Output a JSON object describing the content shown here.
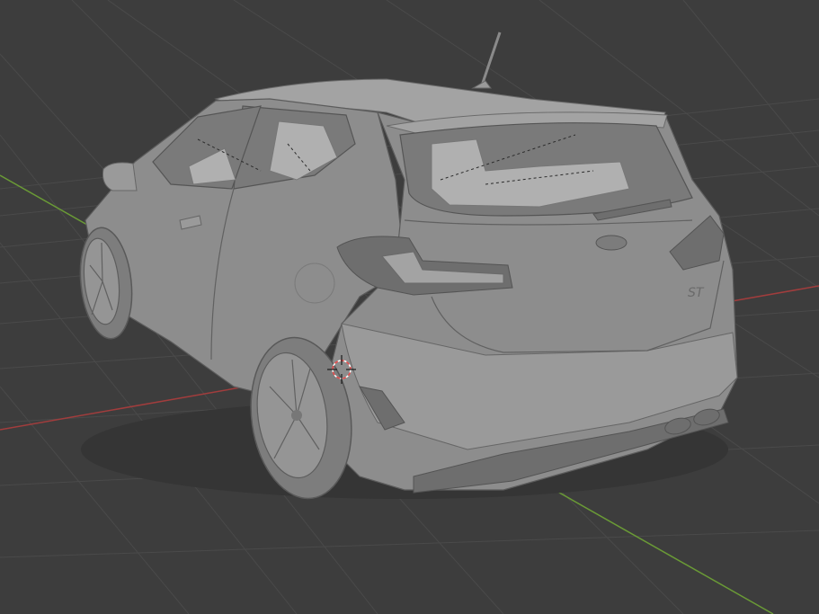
{
  "viewport": {
    "background": "#3d3d3d",
    "grid_color": "#4a4a4a",
    "x_axis_color": "#a13d3d",
    "y_axis_color": "#6a9a36"
  },
  "model": {
    "name": "hatchback-car",
    "shading": "solid",
    "body_color": "#8d8d8d"
  },
  "cursor": {
    "icon": "3d-cursor-icon",
    "colors": [
      "#e84b4b",
      "#ffffff"
    ]
  }
}
